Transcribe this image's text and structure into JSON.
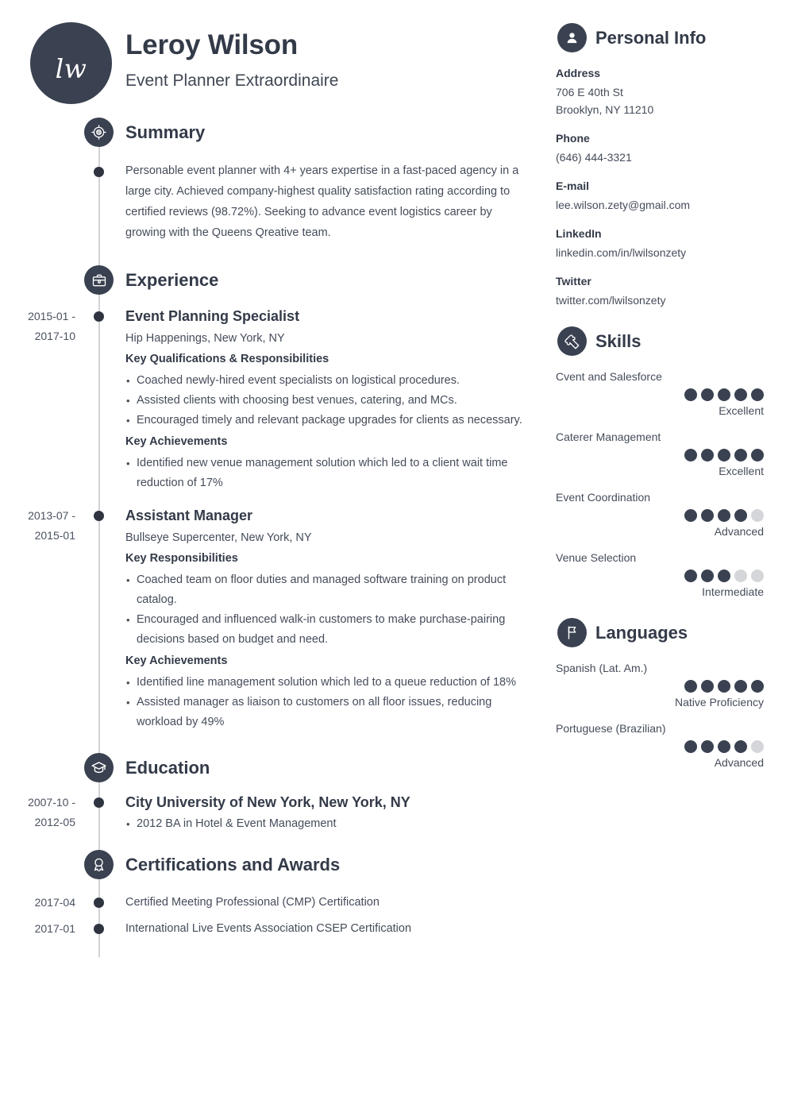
{
  "theme": {
    "dark": "#3a4150",
    "text": "#454c5a",
    "dot_off": "#d4d6d9",
    "rail": "#d2d3d6"
  },
  "header": {
    "initials": "lw",
    "name": "Leroy Wilson",
    "job_title": "Event Planner Extraordinaire"
  },
  "sections": {
    "summary": {
      "title": "Summary",
      "icon": "target-percent-icon",
      "text": "Personable event planner with 4+ years expertise in a fast-paced agency in a large city. Achieved company-highest quality satisfaction rating according to certified reviews (98.72%). Seeking to advance event logistics career by growing with the Queens Qreative team."
    },
    "experience": {
      "title": "Experience",
      "icon": "briefcase-icon",
      "jobs": [
        {
          "dates": "2015-01 - 2017-10",
          "date_line_1": "2015-01 -",
          "date_line_2": "2017-10",
          "title": "Event Planning Specialist",
          "company": "Hip Happenings, New York, NY",
          "groups": [
            {
              "label": "Key Qualifications & Responsibilities",
              "items": [
                "Coached newly-hired event specialists on logistical procedures.",
                "Assisted clients with choosing best venues, catering, and MCs.",
                "Encouraged timely and relevant package upgrades for clients as necessary."
              ]
            },
            {
              "label": "Key Achievements",
              "items": [
                "Identified new venue management solution which led to a client wait time reduction of 17%"
              ]
            }
          ]
        },
        {
          "dates": "2013-07 - 2015-01",
          "date_line_1": "2013-07 -",
          "date_line_2": "2015-01",
          "title": "Assistant Manager",
          "company": "Bullseye Supercenter, New York, NY",
          "groups": [
            {
              "label": "Key Responsibilities",
              "items": [
                "Coached team on floor duties and managed software training on product catalog.",
                "Encouraged and influenced walk-in customers to make purchase-pairing decisions based on budget and need."
              ]
            },
            {
              "label": "Key Achievements",
              "items": [
                "Identified line management solution which led to a queue reduction of 18%",
                "Assisted manager as liaison to customers on all floor issues, reducing workload by 49%"
              ]
            }
          ]
        }
      ]
    },
    "education": {
      "title": "Education",
      "icon": "graduation-cap-icon",
      "entries": [
        {
          "date_line_1": "2007-10 -",
          "date_line_2": "2012-05",
          "school": "City University of New York, New York, NY",
          "items": [
            "2012 BA in Hotel & Event Management"
          ]
        }
      ]
    },
    "certifications": {
      "title": "Certifications and Awards",
      "icon": "award-ribbon-icon",
      "entries": [
        {
          "date": "2017-04",
          "text": "Certified Meeting Professional (CMP) Certification"
        },
        {
          "date": "2017-01",
          "text": "International Live Events Association CSEP Certification"
        }
      ]
    }
  },
  "sidebar": {
    "personal_info": {
      "title": "Personal Info",
      "icon": "person-icon",
      "groups": [
        {
          "label": "Address",
          "values": [
            "706 E 40th St",
            "Brooklyn, NY 11210"
          ]
        },
        {
          "label": "Phone",
          "values": [
            "(646) 444-3321"
          ]
        },
        {
          "label": "E-mail",
          "values": [
            "lee.wilson.zety@gmail.com"
          ]
        },
        {
          "label": "LinkedIn",
          "values": [
            "linkedin.com/in/lwilsonzety"
          ]
        },
        {
          "label": "Twitter",
          "values": [
            "twitter.com/lwilsonzety"
          ]
        }
      ]
    },
    "skills": {
      "title": "Skills",
      "icon": "puzzle-piece-icon",
      "max": 5,
      "items": [
        {
          "name": "Cvent and Salesforce",
          "rating": 5,
          "level": "Excellent"
        },
        {
          "name": "Caterer Management",
          "rating": 5,
          "level": "Excellent"
        },
        {
          "name": "Event Coordination",
          "rating": 4,
          "level": "Advanced"
        },
        {
          "name": "Venue Selection",
          "rating": 3,
          "level": "Intermediate"
        }
      ]
    },
    "languages": {
      "title": "Languages",
      "icon": "flag-icon",
      "max": 5,
      "items": [
        {
          "name": "Spanish (Lat. Am.)",
          "rating": 5,
          "level": "Native Proficiency"
        },
        {
          "name": "Portuguese (Brazilian)",
          "rating": 4,
          "level": "Advanced"
        }
      ]
    }
  }
}
